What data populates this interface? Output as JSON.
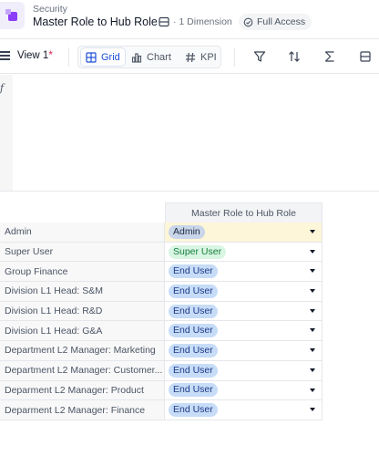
{
  "header": {
    "breadcrumb": "Security",
    "title": "Master Role to Hub Role",
    "dimension_label": "· 1 Dimension",
    "access_label": "Full Access",
    "icons": [
      "app-icon",
      "dimension-icon",
      "access-icon"
    ]
  },
  "toolbar": {
    "view_label": "View 1",
    "view_modified": "*",
    "views": [
      {
        "label": "Grid",
        "icon": "grid-icon",
        "active": true
      },
      {
        "label": "Chart",
        "icon": "chart-icon",
        "active": false
      },
      {
        "label": "KPI",
        "icon": "kpi-icon",
        "active": false
      }
    ],
    "tools": [
      "filter-icon",
      "sort-icon",
      "sum-icon",
      "layout-icon"
    ]
  },
  "formula_bar": {
    "fx_label": "f",
    "value": ""
  },
  "grid": {
    "column_header": "Master Role to Hub Role",
    "rows": [
      {
        "label": "Admin",
        "value": "Admin",
        "kind": "admin"
      },
      {
        "label": "Super User",
        "value": "Super User",
        "kind": "super"
      },
      {
        "label": "Group Finance",
        "value": "End User",
        "kind": "end"
      },
      {
        "label": "Division L1 Head: S&M",
        "value": "End User",
        "kind": "end"
      },
      {
        "label": "Division L1 Head: R&D",
        "value": "End User",
        "kind": "end"
      },
      {
        "label": "Division L1 Head: G&A",
        "value": "End User",
        "kind": "end"
      },
      {
        "label": "Department L2 Manager: Marketing",
        "value": "End User",
        "kind": "end"
      },
      {
        "label": "Department L2 Manager: Customer...",
        "value": "End User",
        "kind": "end"
      },
      {
        "label": "Deparment L2 Manager: Product",
        "value": "End User",
        "kind": "end"
      },
      {
        "label": "Deparment L2 Manager: Finance",
        "value": "End User",
        "kind": "end"
      }
    ]
  },
  "colors": {
    "accent": "#1d4ed8",
    "highlight_row": "#fdf6d8",
    "super_user_pill": "#d9f5e3",
    "end_user_pill": "#c6dcf7"
  }
}
